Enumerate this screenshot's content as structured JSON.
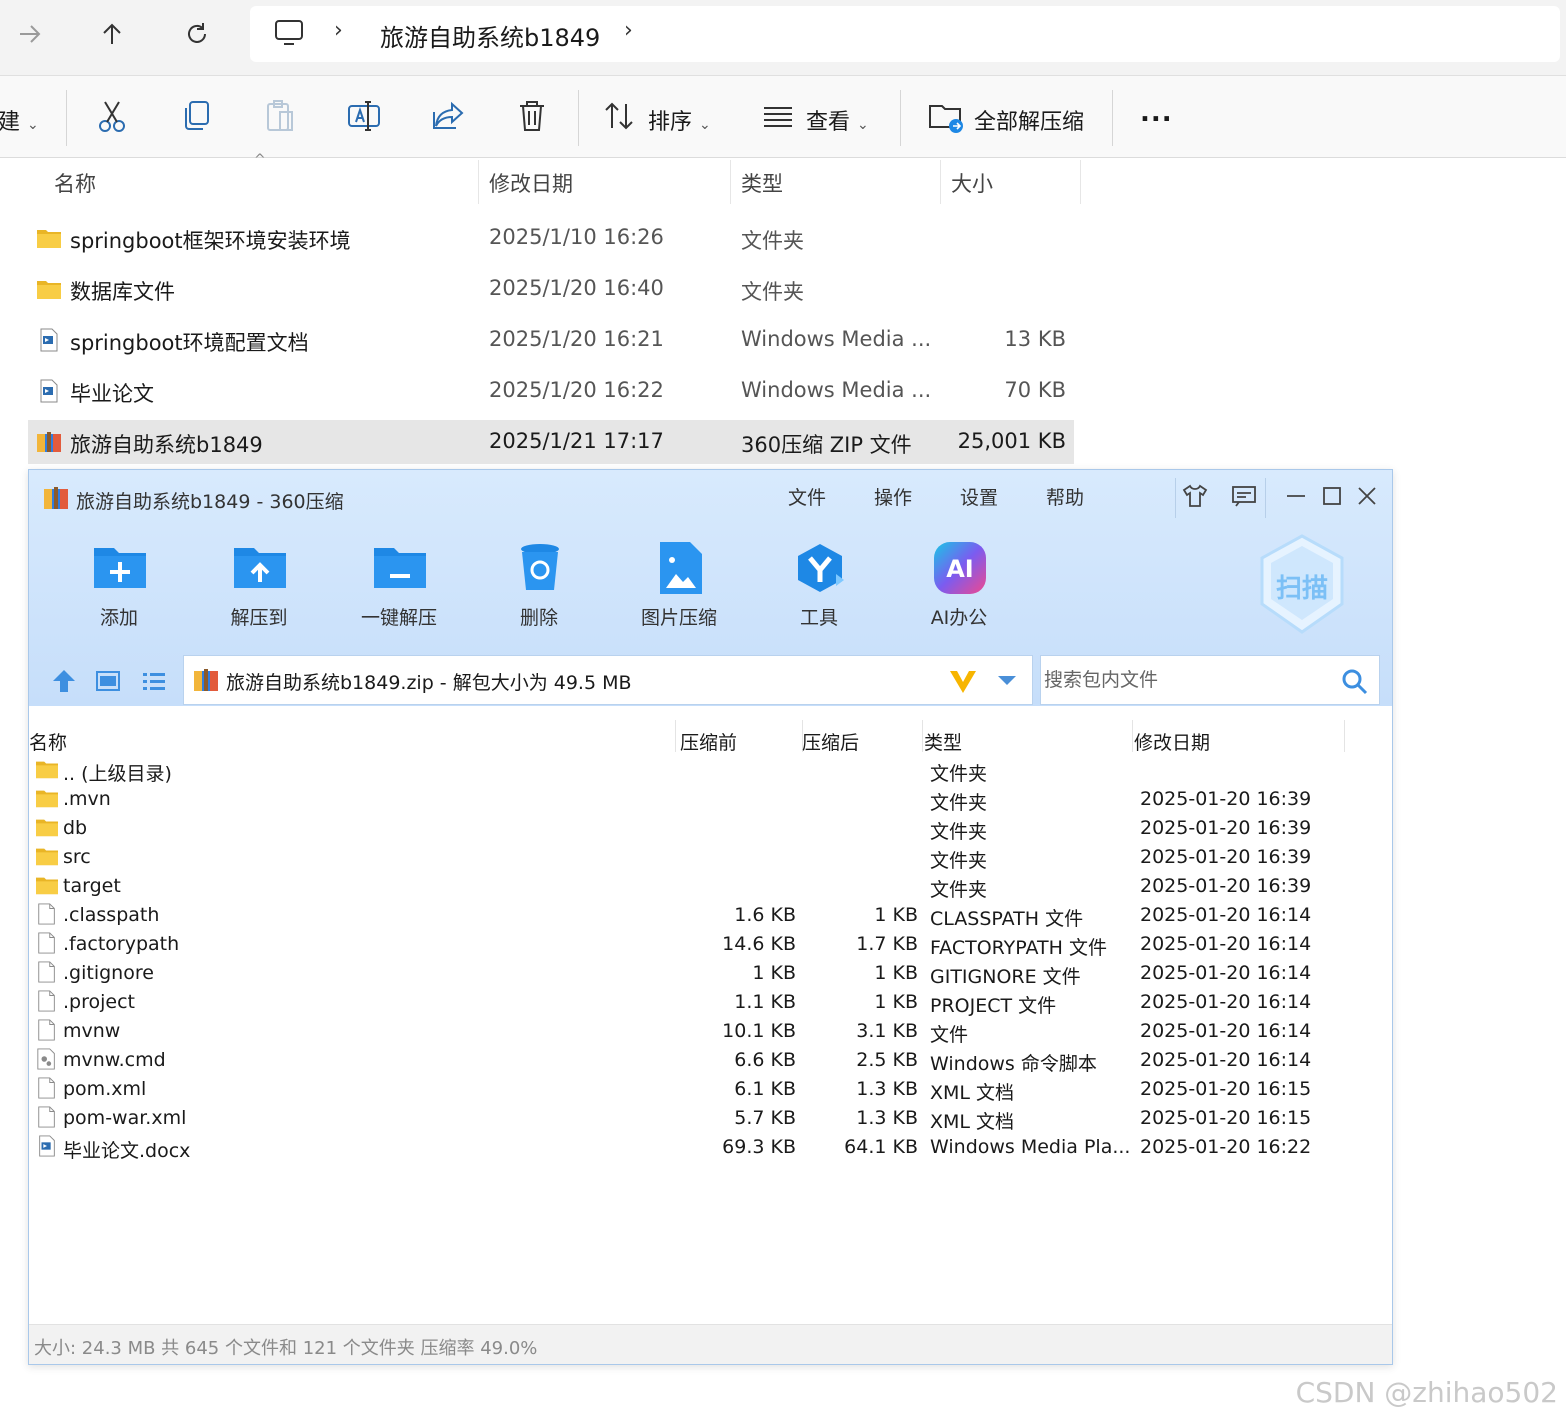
{
  "explorer": {
    "nav": {
      "forward_icon": "arrow-right-icon",
      "up_icon": "arrow-up-icon",
      "refresh_icon": "refresh-icon",
      "computer_icon": "monitor-icon"
    },
    "breadcrumb": {
      "current": "旅游自助系统b1849"
    },
    "toolbar": {
      "new_label_fragment": "建",
      "sort_label": "排序",
      "view_label": "查看",
      "extract_all_label": "全部解压缩",
      "more_label": "..."
    },
    "columns": {
      "name": "名称",
      "date": "修改日期",
      "type": "类型",
      "size": "大小"
    },
    "files": [
      {
        "name": "springboot框架环境安装环境",
        "date": "2025/1/10 16:26",
        "type": "文件夹",
        "size": "",
        "icon": "folder-icon"
      },
      {
        "name": "数据库文件",
        "date": "2025/1/20 16:40",
        "type": "文件夹",
        "size": "",
        "icon": "folder-icon"
      },
      {
        "name": "springboot环境配置文档",
        "date": "2025/1/20 16:21",
        "type": "Windows Media ...",
        "size": "13 KB",
        "icon": "document-icon"
      },
      {
        "name": "毕业论文",
        "date": "2025/1/20 16:22",
        "type": "Windows Media ...",
        "size": "70 KB",
        "icon": "document-icon"
      },
      {
        "name": "旅游自助系统b1849",
        "date": "2025/1/21 17:17",
        "type": "360压缩 ZIP 文件",
        "size": "25,001 KB",
        "icon": "zip-archive-icon"
      }
    ]
  },
  "zip_window": {
    "title": "旅游自助系统b1849 - 360压缩",
    "menu": [
      "文件",
      "操作",
      "设置",
      "帮助"
    ],
    "tools": [
      {
        "label": "添加",
        "icon": "add-folder-icon"
      },
      {
        "label": "解压到",
        "icon": "extract-to-icon"
      },
      {
        "label": "一键解压",
        "icon": "one-click-extract-icon"
      },
      {
        "label": "删除",
        "icon": "delete-bin-icon"
      },
      {
        "label": "图片压缩",
        "icon": "image-compress-icon"
      },
      {
        "label": "工具",
        "icon": "tools-icon"
      },
      {
        "label": "AI办公",
        "icon": "ai-office-icon"
      }
    ],
    "scan_label": "扫描",
    "ai_badge": "AI",
    "address": "旅游自助系统b1849.zip - 解包大小为 49.5 MB",
    "search_placeholder": "搜索包内文件",
    "columns": {
      "name": "名称",
      "before": "压缩前",
      "after": "压缩后",
      "type": "类型",
      "date": "修改日期"
    },
    "entries": [
      {
        "name": ".. (上级目录)",
        "before": "",
        "after": "",
        "type": "文件夹",
        "date": "",
        "icon": "folder-icon"
      },
      {
        "name": ".mvn",
        "before": "",
        "after": "",
        "type": "文件夹",
        "date": "2025-01-20 16:39",
        "icon": "folder-icon"
      },
      {
        "name": "db",
        "before": "",
        "after": "",
        "type": "文件夹",
        "date": "2025-01-20 16:39",
        "icon": "folder-icon"
      },
      {
        "name": "src",
        "before": "",
        "after": "",
        "type": "文件夹",
        "date": "2025-01-20 16:39",
        "icon": "folder-icon"
      },
      {
        "name": "target",
        "before": "",
        "after": "",
        "type": "文件夹",
        "date": "2025-01-20 16:39",
        "icon": "folder-icon"
      },
      {
        "name": ".classpath",
        "before": "1.6 KB",
        "after": "1 KB",
        "type": "CLASSPATH 文件",
        "date": "2025-01-20 16:14",
        "icon": "file-icon"
      },
      {
        "name": ".factorypath",
        "before": "14.6 KB",
        "after": "1.7 KB",
        "type": "FACTORYPATH 文件",
        "date": "2025-01-20 16:14",
        "icon": "file-icon"
      },
      {
        "name": ".gitignore",
        "before": "1 KB",
        "after": "1 KB",
        "type": "GITIGNORE 文件",
        "date": "2025-01-20 16:14",
        "icon": "file-icon"
      },
      {
        "name": ".project",
        "before": "1.1 KB",
        "after": "1 KB",
        "type": "PROJECT 文件",
        "date": "2025-01-20 16:14",
        "icon": "file-icon"
      },
      {
        "name": "mvnw",
        "before": "10.1 KB",
        "after": "3.1 KB",
        "type": "文件",
        "date": "2025-01-20 16:14",
        "icon": "file-icon"
      },
      {
        "name": "mvnw.cmd",
        "before": "6.6 KB",
        "after": "2.5 KB",
        "type": "Windows 命令脚本",
        "date": "2025-01-20 16:14",
        "icon": "script-file-icon"
      },
      {
        "name": "pom.xml",
        "before": "6.1 KB",
        "after": "1.3 KB",
        "type": "XML 文档",
        "date": "2025-01-20 16:15",
        "icon": "file-icon"
      },
      {
        "name": "pom-war.xml",
        "before": "5.7 KB",
        "after": "1.3 KB",
        "type": "XML 文档",
        "date": "2025-01-20 16:15",
        "icon": "file-icon"
      },
      {
        "name": "毕业论文.docx",
        "before": "69.3 KB",
        "after": "64.1 KB",
        "type": "Windows Media Pla...",
        "date": "2025-01-20 16:22",
        "icon": "document-icon"
      }
    ],
    "status": "大小: 24.3 MB 共 645 个文件和 121 个文件夹 压缩率 49.0%"
  },
  "watermark": "CSDN @zhihao502",
  "colors": {
    "folder": "#f5c842",
    "accent_blue": "#1e88e5",
    "window_bg": "#d3e6fc",
    "selection": "#e6e6e6"
  }
}
